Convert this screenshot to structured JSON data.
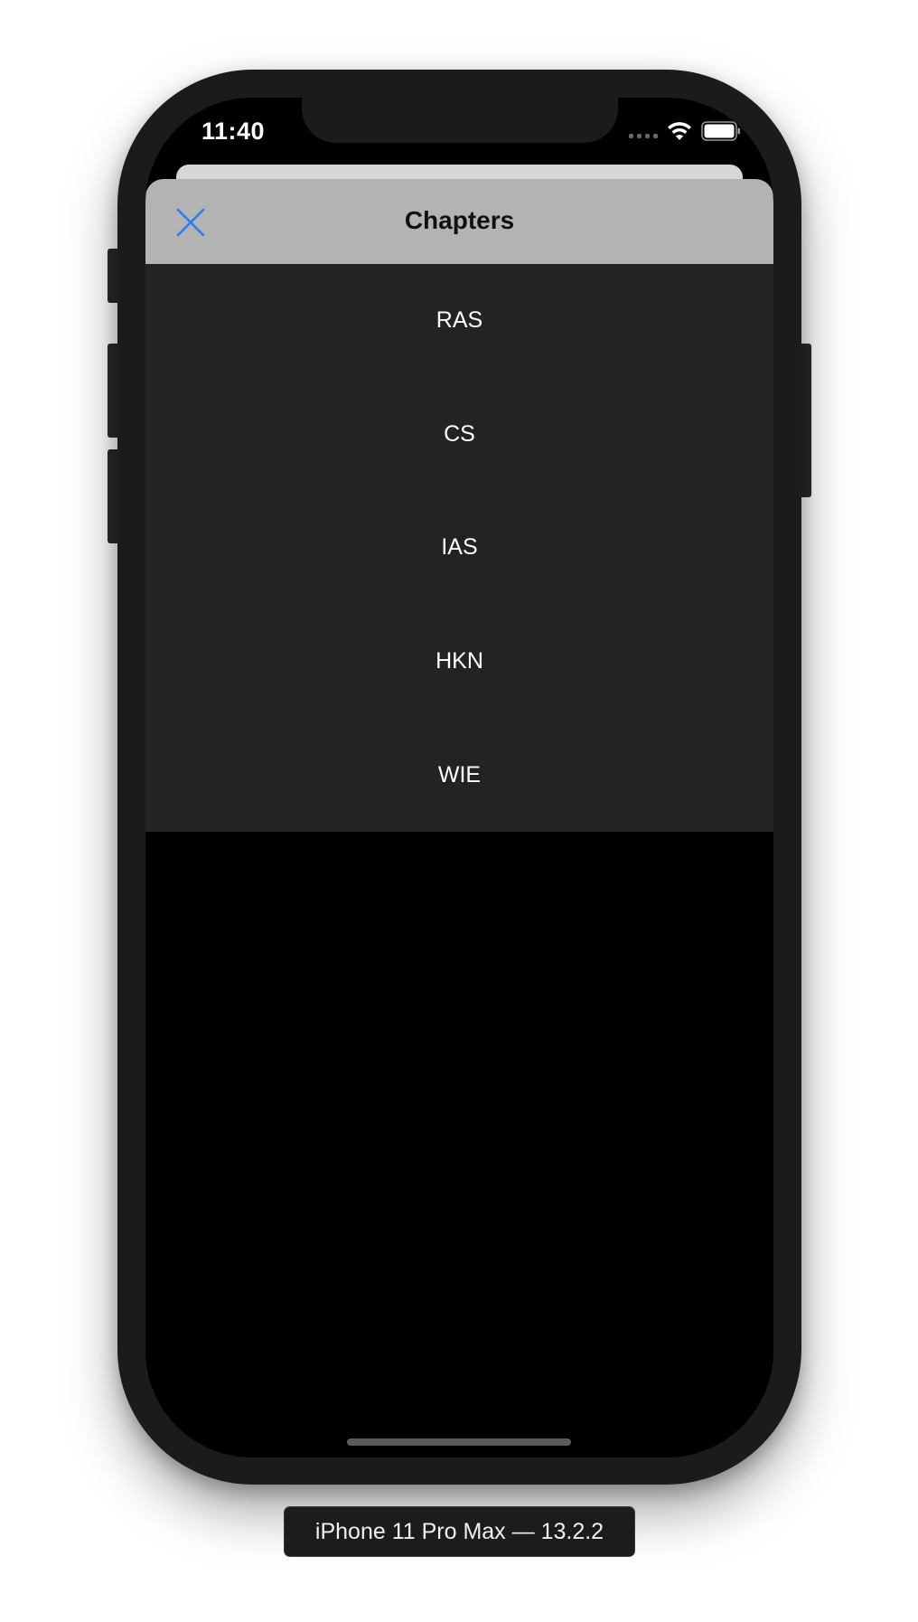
{
  "status_bar": {
    "time": "11:40"
  },
  "sheet": {
    "title": "Chapters",
    "close_icon": "close-icon",
    "accent_color": "#2f7bf5"
  },
  "chapters": [
    {
      "label": "RAS"
    },
    {
      "label": "CS"
    },
    {
      "label": "IAS"
    },
    {
      "label": "HKN"
    },
    {
      "label": "WIE"
    }
  ],
  "device_label": "iPhone 11 Pro Max — 13.2.2"
}
